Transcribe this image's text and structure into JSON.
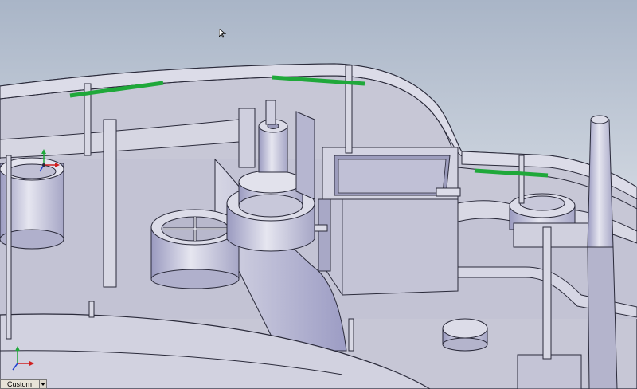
{
  "viewport": {
    "background_top": "#aab6c8",
    "background_bottom": "#e9ecf0",
    "model_color": "#c9c9d8",
    "model_shade": "#a8a8c4",
    "edge_color": "#2a2a3a",
    "highlight_color": "#1fa83a"
  },
  "triads": [
    {
      "name": "triad-icon"
    },
    {
      "name": "reference-triad-icon"
    }
  ],
  "view_selector": {
    "value": "Custom",
    "icon": "chevron-down-icon"
  },
  "cursor": {
    "icon": "mouse-pointer-icon"
  }
}
